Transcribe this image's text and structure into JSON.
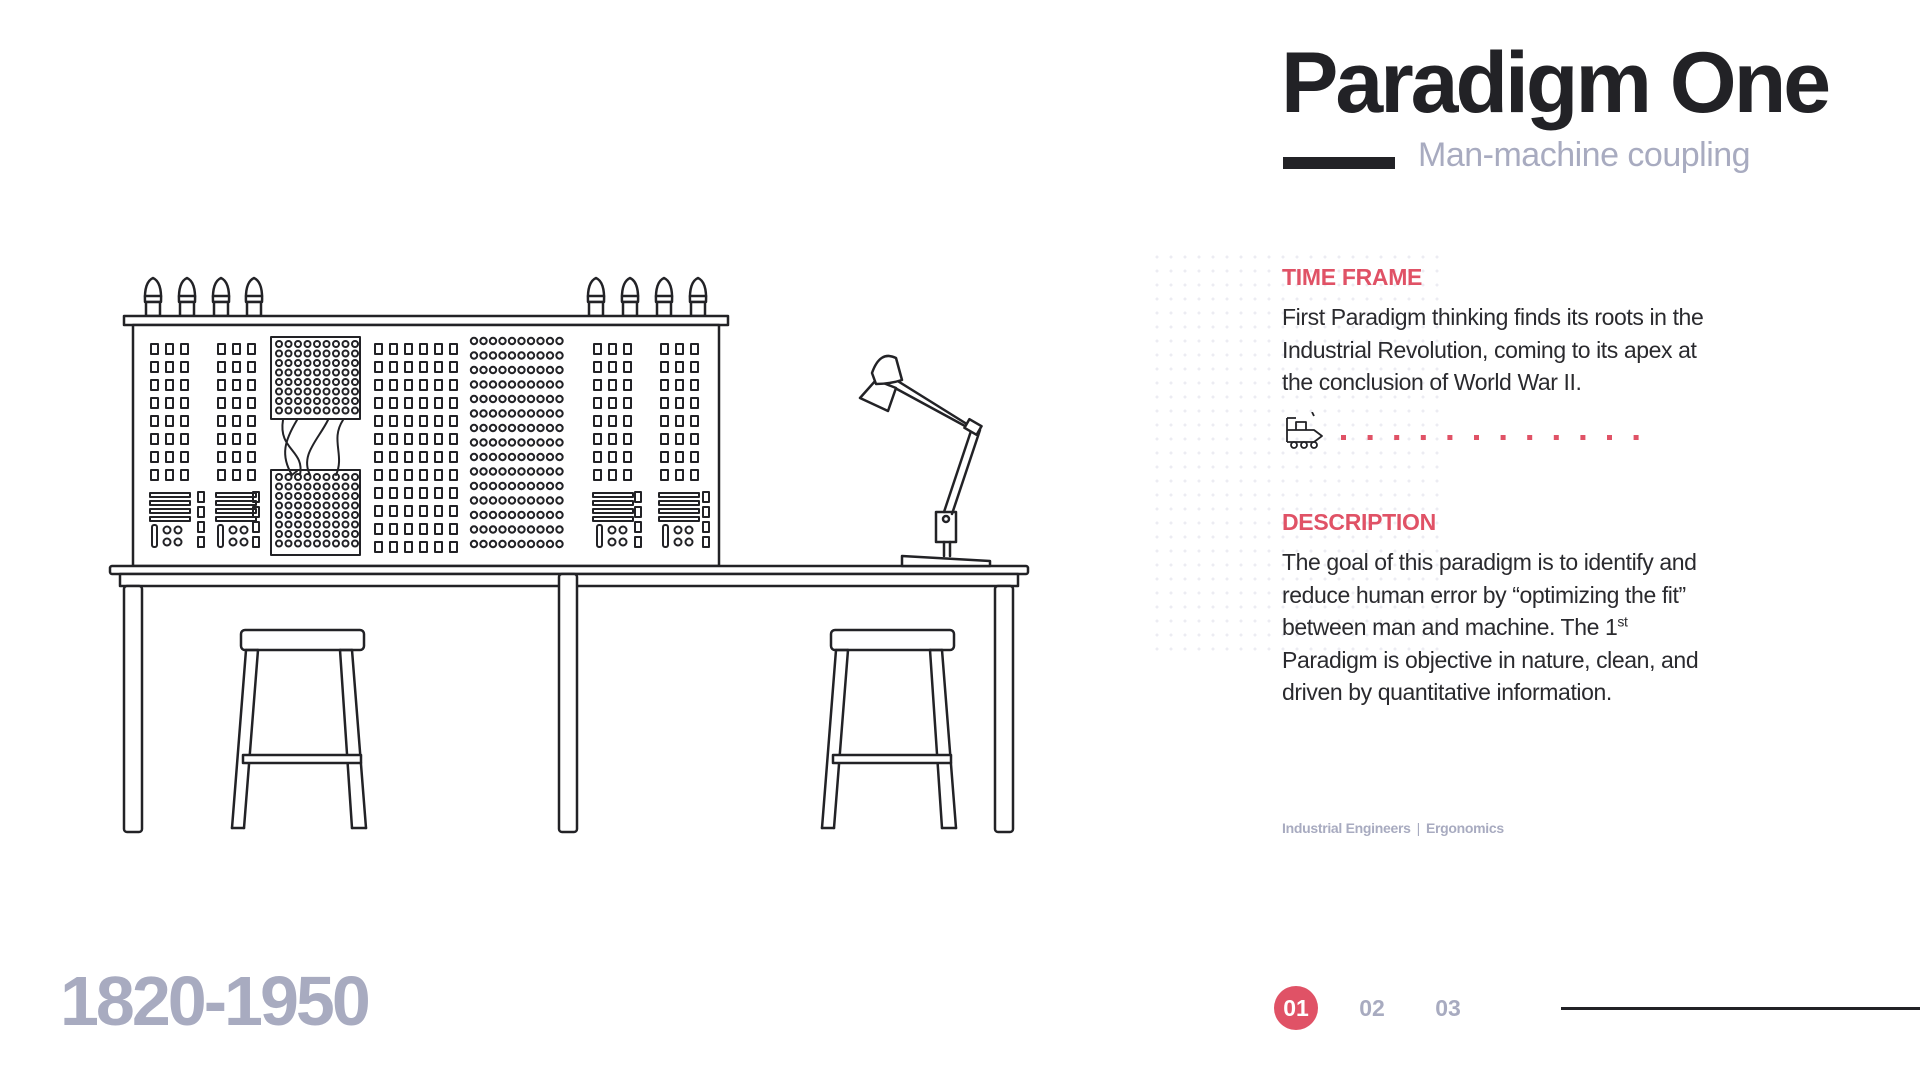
{
  "header": {
    "title": "Paradigm One",
    "subtitle": "Man-machine coupling"
  },
  "time_frame": {
    "label": "TIME FRAME",
    "text": "First Paradigm thinking finds its roots in the Industrial Revolution, coming to its apex at the conclusion of World War II."
  },
  "description": {
    "label": "DESCRIPTION",
    "text_before_sup": "The goal of this paradigm is to identify and reduce human error by “optimizing the fit” between man and machine. The 1",
    "sup": "st",
    "text_after_sup": " Paradigm is objective in nature, clean, and driven by quantitative information."
  },
  "tags": [
    "Industrial Engineers",
    "Ergonomics"
  ],
  "tag_separator": "|",
  "years": "1820-1950",
  "pagination": {
    "pages": [
      "01",
      "02",
      "03"
    ],
    "active": "01"
  },
  "colors": {
    "accent": "#e05266",
    "ink": "#222226",
    "muted": "#a8abc0",
    "background": "#ffffff"
  },
  "icons": {
    "timeline_marker": "train-icon",
    "illustration": "control-panel-desk-illustration"
  }
}
